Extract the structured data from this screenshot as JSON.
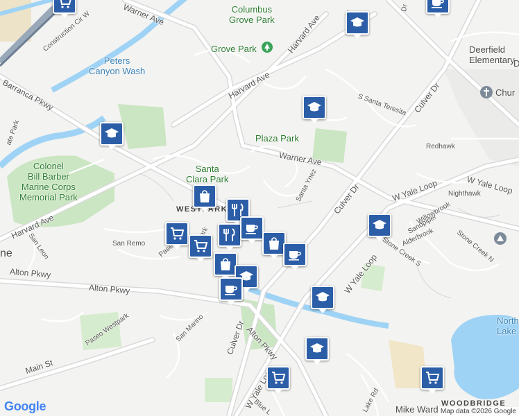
{
  "map": {
    "labels": {
      "columbus_grove_park": "Columbus\nGrove Park",
      "grove_park": "Grove Park",
      "peters_canyon_wash": "Peters\nCanyon Wash",
      "plaza_park": "Plaza Park",
      "santa_clara_park": "Santa\nClara Park",
      "colonel_bill_barber": "Colonel\nBill Barber\nMarine Corps\nMemorial Park",
      "westpark": "WESTPARK",
      "woodbridge": "WOODBRIDGE",
      "elementary": "Deerfield\nElementary",
      "church": "Chur",
      "north_lake_park": "North\nLake Park",
      "mike_ward": "Mike Ward",
      "irvine_partial": "ne"
    },
    "roads": {
      "warner_ave_top": "Warner Ave",
      "warner_ave_mid": "Warner Ave",
      "harvard_ave_top": "Harvard Ave",
      "harvard_ave_mid": "Harvard Ave",
      "harvard_ave_left": "Harvard Ave",
      "barranca_pkwy": "Barranca Pkwy",
      "construction_cir": "Construction Cir W",
      "alton_pkwy_left": "Alton Pkwy",
      "alton_pkwy_mid": "Alton Pkwy",
      "alton_pkwy_diag": "Alton Pkwy",
      "culver_dr_top": "Culver Dr",
      "culver_dr_mid": "Culver Dr",
      "culver_dr_bottom": "Culver Dr",
      "w_yale_loop_a": "W Yale Loop",
      "w_yale_loop_b": "W Yale Loop",
      "w_yale_loop_c": "W Yale Loop",
      "w_yale_loop_d": "W Yale Loop",
      "redhawk": "Redhawk",
      "nighthawk": "Nighthawk",
      "willowbrook": "Willowbrook",
      "sandpiper": "Sandpiper",
      "alderbrook": "Alderbrook",
      "stone_creek_s": "Stone Creek S",
      "stone_creek_n": "Stone Creek N",
      "san_remo": "San Remo",
      "san_leon": "San Leon",
      "san_marino": "San Marino",
      "paseo_westpark": "Paseo Westpark",
      "paseo_westpark_short": "Pase",
      "santa_ynez": "Santa Ynez",
      "s_santa_teresita": "S Santa Teresita",
      "paseo_top": "Paseo",
      "main_st": "Main St",
      "blue_lake": "Blue L",
      "lake_rd": "Lake Rd",
      "park_short": "Park",
      "gate_park": "ate Park",
      "dr_short": "Dr",
      "d_short": "D"
    },
    "markers": [
      {
        "type": "shopping-cart-icon"
      },
      {
        "type": "coffee-icon"
      },
      {
        "type": "school-icon"
      },
      {
        "type": "school-icon"
      },
      {
        "type": "school-icon"
      },
      {
        "type": "shopping-bag-icon"
      },
      {
        "type": "restaurant-icon"
      },
      {
        "type": "shopping-cart-icon"
      },
      {
        "type": "shopping-cart-icon"
      },
      {
        "type": "restaurant-icon"
      },
      {
        "type": "coffee-icon"
      },
      {
        "type": "shopping-bag-icon"
      },
      {
        "type": "coffee-icon"
      },
      {
        "type": "shopping-bag-icon"
      },
      {
        "type": "school-icon"
      },
      {
        "type": "coffee-icon"
      },
      {
        "type": "school-icon"
      },
      {
        "type": "school-icon"
      },
      {
        "type": "shopping-cart-icon"
      },
      {
        "type": "shopping-cart-icon"
      }
    ],
    "google_logo": "Google",
    "attribution": "Map data ©2026 Google"
  }
}
